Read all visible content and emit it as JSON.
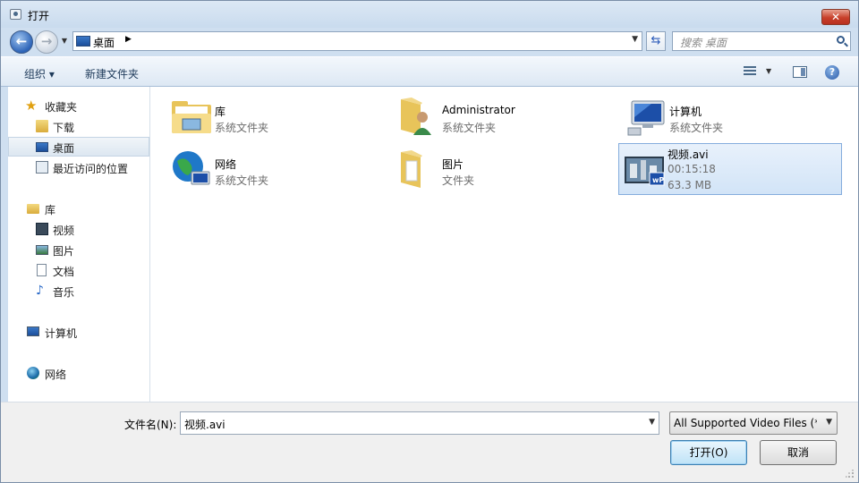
{
  "window": {
    "title": "打开",
    "close_glyph": "✕"
  },
  "nav": {
    "back_glyph": "←",
    "forward_glyph": "→",
    "address": {
      "current": "桌面"
    },
    "search": {
      "placeholder": "搜索 桌面"
    }
  },
  "toolbar": {
    "organize": "组织 ▾",
    "new_folder": "新建文件夹"
  },
  "sidebar": {
    "groups": [
      {
        "label": "收藏夹",
        "icon": "star-icon",
        "children": [
          {
            "label": "下载",
            "icon": "download-folder-icon"
          },
          {
            "label": "桌面",
            "icon": "desktop-icon",
            "selected": true
          },
          {
            "label": "最近访问的位置",
            "icon": "recent-places-icon"
          }
        ]
      },
      {
        "label": "库",
        "icon": "library-icon",
        "children": [
          {
            "label": "视频",
            "icon": "video-icon"
          },
          {
            "label": "图片",
            "icon": "picture-icon"
          },
          {
            "label": "文档",
            "icon": "document-icon"
          },
          {
            "label": "音乐",
            "icon": "music-icon"
          }
        ]
      },
      {
        "label": "计算机",
        "icon": "computer-icon"
      },
      {
        "label": "网络",
        "icon": "network-icon"
      }
    ]
  },
  "items": [
    {
      "name": "库",
      "sub": "系统文件夹",
      "icon": "library-folder-icon"
    },
    {
      "name": "Administrator",
      "sub": "系统文件夹",
      "icon": "user-folder-icon"
    },
    {
      "name": "计算机",
      "sub": "系统文件夹",
      "icon": "computer-icon"
    },
    {
      "name": "网络",
      "sub": "系统文件夹",
      "icon": "network-globe-icon"
    },
    {
      "name": "图片",
      "sub": "文件夹",
      "icon": "folder-icon"
    },
    {
      "name": "视频.avi",
      "sub": "00:15:18",
      "sub2": "63.3 MB",
      "icon": "video-file-icon",
      "selected": true
    }
  ],
  "bottom": {
    "filename_label": "文件名(N):",
    "filename_value": "视频.avi",
    "filter_value": "All Supported Video Files (*.",
    "open_button": "打开(O)",
    "cancel_button": "取消"
  }
}
